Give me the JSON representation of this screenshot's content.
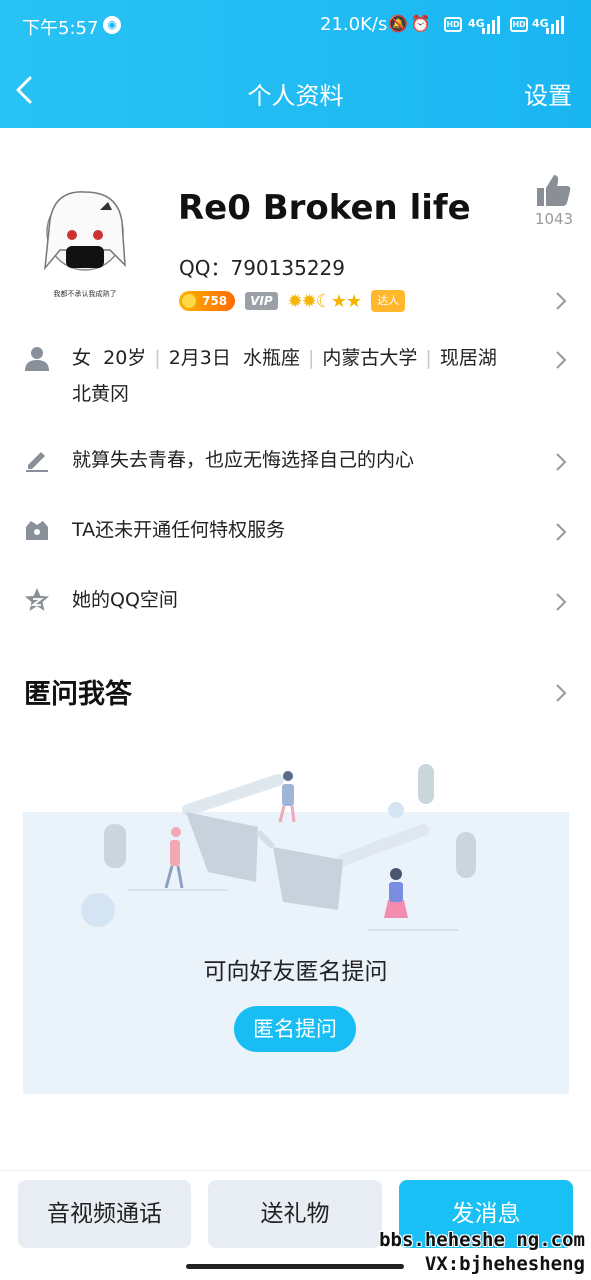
{
  "status_bar": {
    "time": "下午5:57",
    "speed": "21.0K/s",
    "net1": "4G",
    "net2": "4G",
    "icons": [
      "wechat-icon",
      "mute-icon",
      "alarm-icon",
      "hd-icon",
      "signal-icon",
      "hd-icon",
      "signal-icon"
    ]
  },
  "nav": {
    "title": "个人资料",
    "settings": "设置"
  },
  "profile": {
    "name": "Re0 Broken life",
    "qq": "QQ：790135229",
    "likes": "1043",
    "coin_level": "758",
    "vip": "VIP",
    "level_icons": "✹✹☾★★",
    "daren": "达人",
    "avatar_caption": "我都不承认我成熟了"
  },
  "info_rows": {
    "basic": {
      "gender": "女",
      "age": "20岁",
      "birthday": "2月3日",
      "zodiac": "水瓶座",
      "school": "内蒙古大学",
      "location_line1": "现居湖",
      "location_line2": "北黄冈"
    },
    "signature": "就算失去青春，也应无悔选择自己的内心",
    "privilege": "TA还未开通任何特权服务",
    "qzone": "她的QQ空间"
  },
  "qa_section": {
    "title": "匿问我答",
    "prompt": "可向好友匿名提问",
    "button": "匿名提问"
  },
  "bottom_actions": {
    "call": "音视频通话",
    "gift": "送礼物",
    "message": "发消息"
  },
  "watermark": {
    "line1": "bbs.heheshe ng.com",
    "line2": "VX:bjhehesheng"
  },
  "colors": {
    "header_gradient": [
      "#28c2f4",
      "#1ab6f2"
    ],
    "accent": "#17bdf3",
    "panel_bg": "#eaf2fa",
    "button_bg": "#e8edf3"
  }
}
